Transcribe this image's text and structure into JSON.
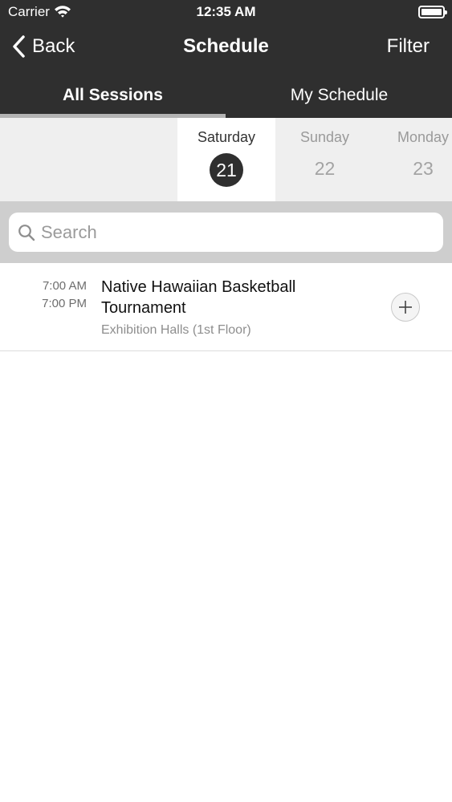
{
  "status_bar": {
    "carrier": "Carrier",
    "time": "12:35 AM"
  },
  "nav": {
    "back_label": "Back",
    "title": "Schedule",
    "filter_label": "Filter"
  },
  "tabs": [
    {
      "label": "All Sessions",
      "selected": true
    },
    {
      "label": "My Schedule",
      "selected": false
    }
  ],
  "days": [
    {
      "weekday": "Saturday",
      "date": "21",
      "selected": true
    },
    {
      "weekday": "Sunday",
      "date": "22",
      "selected": false
    },
    {
      "weekday": "Monday",
      "date": "23",
      "selected": false
    }
  ],
  "search": {
    "placeholder": "Search",
    "value": ""
  },
  "sessions": [
    {
      "start": "7:00 AM",
      "end": "7:00 PM",
      "title": "Native Hawaiian Basketball Tournament",
      "location": "Exhibition Halls (1st Floor)"
    }
  ],
  "colors": {
    "header": "#2f2f2f",
    "selected_day": "#2f2f2f",
    "search_bar_bg": "#cecece"
  },
  "icons": {
    "back": "chevron-left-icon",
    "wifi": "wifi-icon",
    "battery": "battery-icon",
    "search": "magnifier-icon",
    "add": "plus-icon"
  }
}
